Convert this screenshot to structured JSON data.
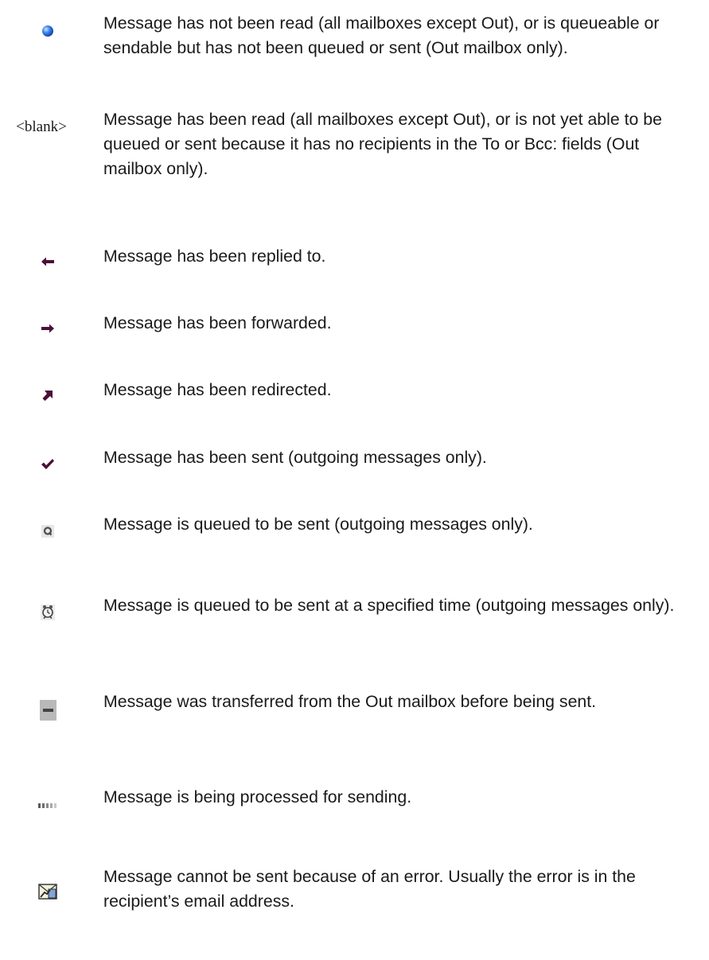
{
  "entries": [
    {
      "icon": "unread-dot-icon",
      "text": "Message has not been read (all mailboxes except Out), or is queueable or sendable but has not been queued or sent (Out mailbox only)."
    },
    {
      "icon": "blank",
      "icon_label": "<blank>",
      "text": "Message has been read (all mailboxes except Out), or is not yet able to be queued or sent because it has no recipients in the To or Bcc: fields (Out mailbox only)."
    },
    {
      "icon": "replied-arrow-icon",
      "text": "Message has been replied to."
    },
    {
      "icon": "forwarded-arrow-icon",
      "text": "Message has been forwarded."
    },
    {
      "icon": "redirected-arrow-icon",
      "text": "Message has been redirected."
    },
    {
      "icon": "sent-check-icon",
      "text": "Message has been sent (outgoing messages only)."
    },
    {
      "icon": "queued-icon",
      "text": "Message is queued to be sent (outgoing messages only)."
    },
    {
      "icon": "queued-timed-icon",
      "text": "Message is queued to be sent at a specified time (outgoing messages only)."
    },
    {
      "icon": "transferred-icon",
      "text": "Message was transferred from the Out mailbox before being sent."
    },
    {
      "icon": "processing-icon",
      "text": "Message is being processed for sending."
    },
    {
      "icon": "error-icon",
      "text": "Message cannot be sent because of an error. Usually the error is in the recipient’s email address."
    }
  ],
  "colors": {
    "arrow": "#4a0f37",
    "unread_dot": "#1e5fd0",
    "text": "#1a1a1a"
  }
}
